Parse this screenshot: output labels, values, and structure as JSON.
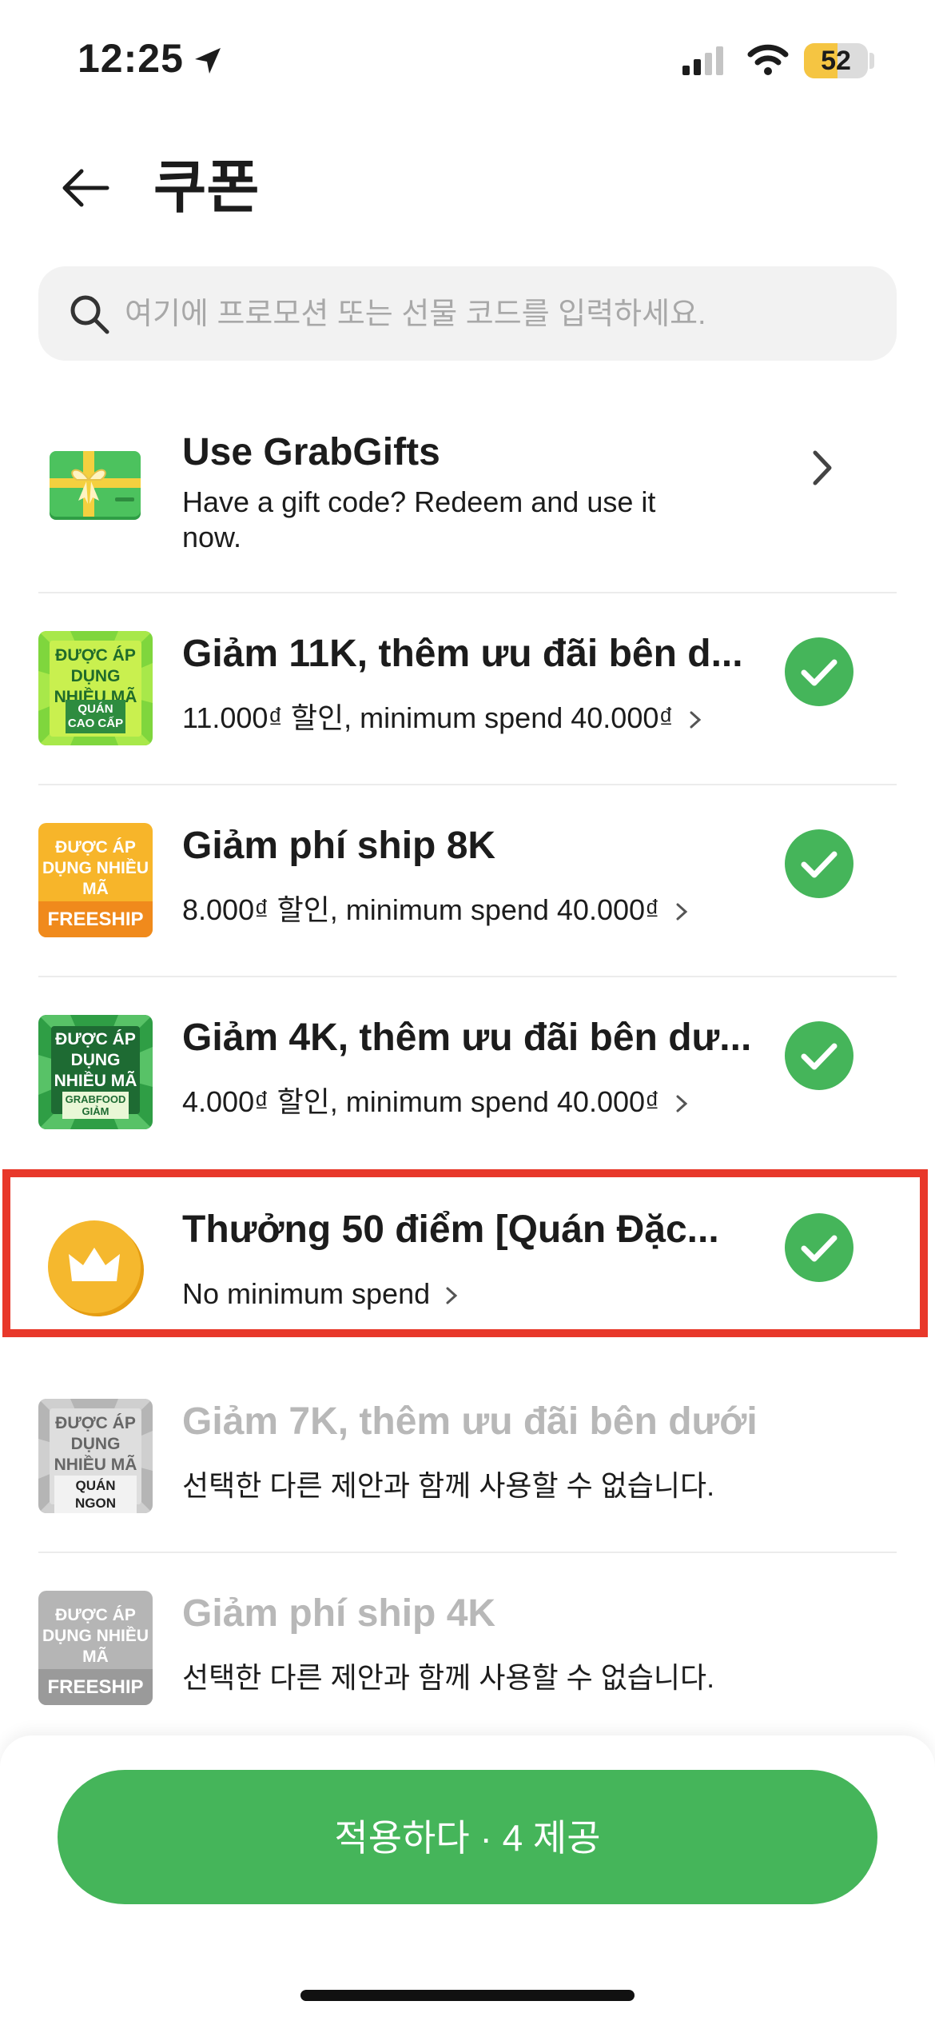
{
  "status_bar": {
    "time": "12:25",
    "battery": "52",
    "battery_level": 0.52
  },
  "header": {
    "title": "쿠폰"
  },
  "search": {
    "placeholder": "여기에 프로모션 또는 선물 코드를 입력하세요."
  },
  "gift": {
    "title": "Use GrabGifts",
    "subtitle": "Have a gift code? Redeem and use it now."
  },
  "coupons": [
    {
      "title": "Giảm 11K, thêm ưu đãi bên d...",
      "description": "11.000₫ 할인, minimum spend 40.000₫",
      "thumb_line1": "ĐƯỢC ÁP DỤNG NHIỀU MÃ",
      "thumb_line2": "QUÁN CAO CẤP",
      "selected": true
    },
    {
      "title": "Giảm phí ship 8K",
      "description": "8.000₫ 할인, minimum spend 40.000₫",
      "thumb_line1": "ĐƯỢC ÁP DỤNG NHIỀU MÃ",
      "thumb_line2": "FREESHIP",
      "selected": true
    },
    {
      "title": "Giảm 4K, thêm ưu đãi bên dư...",
      "description": "4.000₫ 할인, minimum spend 40.000₫",
      "thumb_line1": "ĐƯỢC ÁP DỤNG NHIỀU MÃ",
      "thumb_line2": "GRABFOOD GIẢM",
      "selected": true
    },
    {
      "title": "Thưởng 50 điểm [Quán Đặc...",
      "description": "No minimum spend",
      "selected": true
    },
    {
      "title": "Giảm 7K, thêm ưu đãi bên dưới",
      "description": "선택한 다른 제안과 함께 사용할 수 없습니다.",
      "thumb_line1": "ĐƯỢC ÁP DỤNG NHIỀU MÃ",
      "thumb_line2": "QUÁN NGON",
      "selected": false
    },
    {
      "title": "Giảm phí ship 4K",
      "description": "선택한 다른 제안과 함께 사용할 수 없습니다.",
      "thumb_line1": "ĐƯỢC ÁP DỤNG NHIỀU MÃ",
      "thumb_line2": "FREESHIP",
      "selected": false
    }
  ],
  "apply_button": {
    "label": "적용하다 · 4 제공"
  },
  "colors": {
    "accent_green": "#45b55a",
    "highlight_red": "#e8382a",
    "coin_gold": "#f5b82e",
    "disabled_text": "#b8b8b8"
  }
}
